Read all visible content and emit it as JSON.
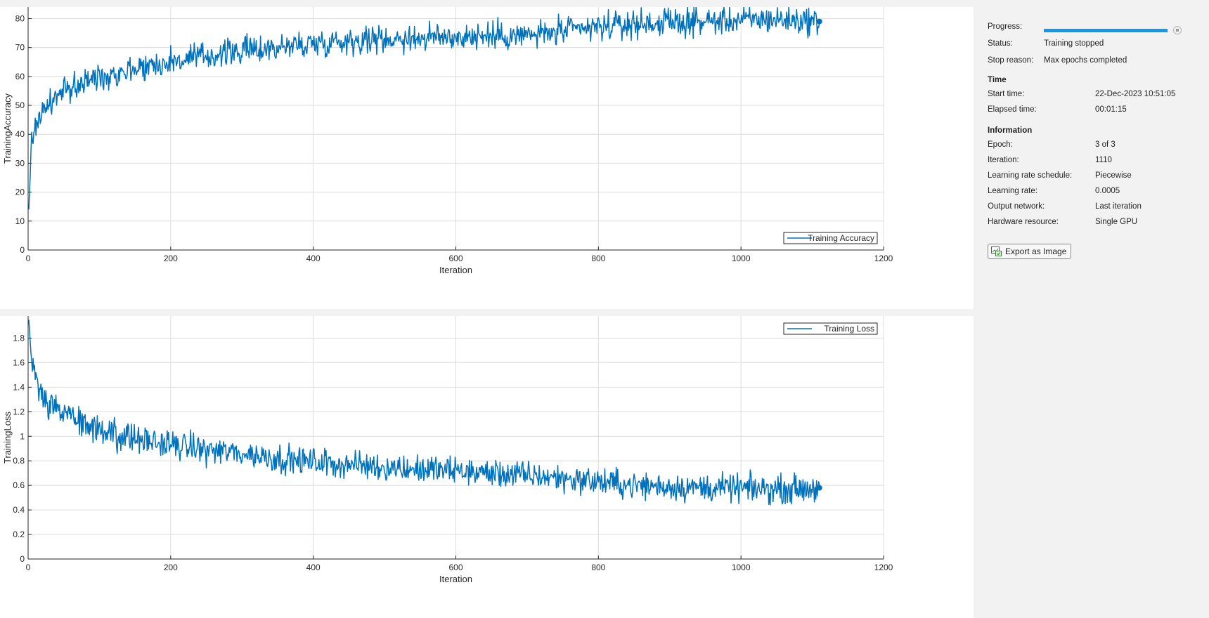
{
  "colors": {
    "line": "#0072BD",
    "progress": "#0e9ae8",
    "grid": "#dcdcdc"
  },
  "info_panel": {
    "progress_label": "Progress:",
    "progress_fraction": 1.0,
    "status_label": "Status:",
    "status_value": "Training stopped",
    "stop_reason_label": "Stop reason:",
    "stop_reason_value": "Max epochs completed",
    "time_heading": "Time",
    "start_time_label": "Start time:",
    "start_time_value": "22-Dec-2023 10:51:05",
    "elapsed_label": "Elapsed time:",
    "elapsed_value": "00:01:15",
    "information_heading": "Information",
    "epoch_label": "Epoch:",
    "epoch_value": "3 of 3",
    "iteration_label": "Iteration:",
    "iteration_value": "1110",
    "lr_schedule_label": "Learning rate schedule:",
    "lr_schedule_value": "Piecewise",
    "lr_label": "Learning rate:",
    "lr_value": "0.0005",
    "output_network_label": "Output network:",
    "output_network_value": "Last iteration",
    "hardware_label": "Hardware resource:",
    "hardware_value": "Single GPU",
    "export_button_label": "Export as Image",
    "stop_icon": "stop-icon",
    "export_icon": "image-export-icon"
  },
  "chart_data": [
    {
      "type": "line",
      "xlabel": "Iteration",
      "ylabel": "TrainingAccuracy",
      "xlim": [
        0,
        1200
      ],
      "ylim": [
        0,
        84
      ],
      "xticks": [
        0,
        200,
        400,
        600,
        800,
        1000,
        1200
      ],
      "yticks": [
        0,
        10,
        20,
        30,
        40,
        50,
        60,
        70,
        80
      ],
      "grid": true,
      "legend_position": "bottom-right",
      "series": [
        {
          "name": "Training Accuracy",
          "final_point": [
            1110,
            79
          ],
          "x": [
            1,
            5,
            10,
            20,
            40,
            60,
            80,
            100,
            150,
            200,
            250,
            300,
            350,
            400,
            450,
            500,
            550,
            600,
            650,
            700,
            750,
            800,
            850,
            900,
            950,
            1000,
            1050,
            1110
          ],
          "y": [
            14,
            38,
            43,
            48,
            53,
            56,
            58,
            60,
            63,
            65,
            67,
            69,
            70,
            71.5,
            72.5,
            73,
            73.3,
            73.8,
            74,
            74.2,
            75.5,
            77,
            78,
            78.7,
            79,
            79.5,
            79.7,
            79
          ]
        }
      ]
    },
    {
      "type": "line",
      "xlabel": "Iteration",
      "ylabel": "TrainingLoss",
      "xlim": [
        0,
        1200
      ],
      "ylim": [
        0,
        1.98
      ],
      "xticks": [
        0,
        200,
        400,
        600,
        800,
        1000,
        1200
      ],
      "yticks": [
        0,
        0.2,
        0.4,
        0.6,
        0.8,
        1,
        1.2,
        1.4,
        1.6,
        1.8
      ],
      "grid": true,
      "legend_position": "top-right",
      "series": [
        {
          "name": "Training Loss",
          "final_point": [
            1110,
            0.58
          ],
          "x": [
            1,
            5,
            10,
            20,
            40,
            60,
            80,
            100,
            150,
            200,
            250,
            300,
            350,
            400,
            450,
            500,
            550,
            600,
            650,
            700,
            750,
            800,
            850,
            900,
            950,
            1000,
            1050,
            1110
          ],
          "y": [
            1.95,
            1.58,
            1.45,
            1.32,
            1.22,
            1.15,
            1.1,
            1.05,
            0.98,
            0.93,
            0.89,
            0.86,
            0.82,
            0.79,
            0.77,
            0.75,
            0.73,
            0.72,
            0.7,
            0.68,
            0.66,
            0.63,
            0.6,
            0.59,
            0.58,
            0.575,
            0.57,
            0.58
          ]
        }
      ]
    }
  ]
}
